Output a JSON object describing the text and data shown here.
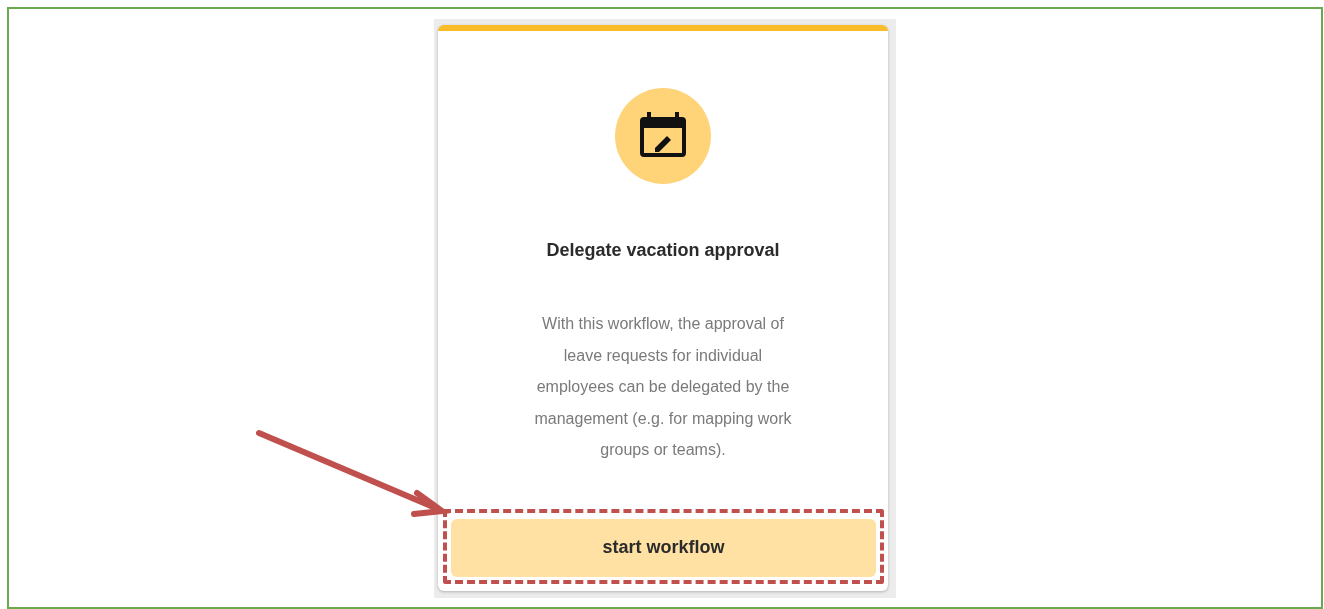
{
  "card": {
    "title": "Delegate vacation approval",
    "description_lines": [
      "With this workflow, the approval of",
      "leave requests for individual",
      "employees can be delegated by the",
      "management (e.g. for mapping work",
      "groups or teams)."
    ],
    "button": "start workflow"
  }
}
